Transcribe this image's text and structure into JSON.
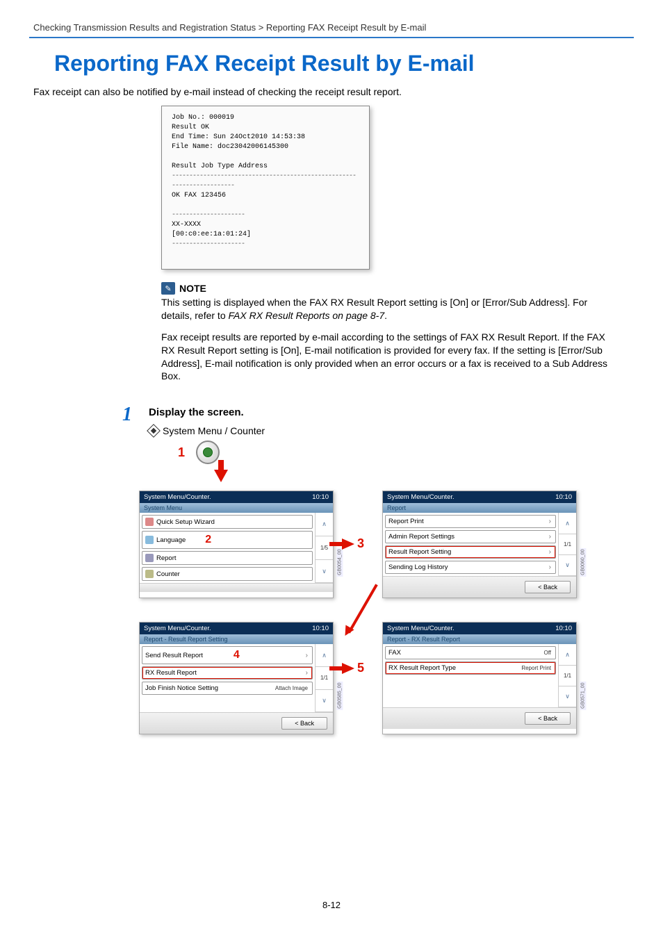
{
  "breadcrumb": "Checking Transmission Results and Registration Status > Reporting FAX Receipt Result by E-mail",
  "title": "Reporting FAX Receipt Result by E-mail",
  "intro": "Fax receipt can also be notified by e-mail instead of checking the receipt result report.",
  "sample": {
    "line1": "Job No.:  000019",
    "line2": "Result   OK",
    "line3": "End Time: Sun 24Oct2010 14:53:38",
    "line4": "File Name: doc23042006145300",
    "hdr": "Result  Job Type   Address",
    "row": " OK     FAX        123456",
    "footer1": "XX-XXXX",
    "footer2": "[00:c0:ee:1a:01:24]"
  },
  "note": {
    "heading": "NOTE",
    "text_a": "This setting is displayed when the FAX RX Result Report setting is [On] or [Error/Sub Address]. For details, refer to ",
    "text_a_link": "FAX RX Result Reports on page 8-7",
    "text_b": "Fax receipt results are reported by e-mail according to the settings of FAX RX Result Report. If the FAX RX Result Report setting is [On], E-mail notification is provided for every fax. If the setting is [Error/Sub Address], E-mail notification is only provided when an error occurs or a fax is received to a Sub Address Box."
  },
  "step1": {
    "num": "1",
    "title": "Display the screen.",
    "menu_label": "System Menu / Counter",
    "marker1": "1"
  },
  "panels": {
    "p1": {
      "title": "System Menu/Counter.",
      "time": "10:10",
      "sub": "System Menu",
      "items": [
        "Quick Setup Wizard",
        "Language",
        "Report",
        "Counter"
      ],
      "page": "1/5",
      "marker": "2",
      "tag": "GB0054_00"
    },
    "p2": {
      "title": "System Menu/Counter.",
      "time": "10:10",
      "sub": "Report",
      "items": [
        "Report Print",
        "Admin Report Settings",
        "Result Report Setting",
        "Sending Log History"
      ],
      "page": "1/1",
      "back": "< Back",
      "tag": "GB0060_00"
    },
    "p3": {
      "title": "System Menu/Counter.",
      "time": "10:10",
      "sub": "Report - Result Report Setting",
      "items": [
        {
          "label": "Send Result Report",
          "right": ""
        },
        {
          "label": "RX Result Report",
          "right": ""
        },
        {
          "label": "Job Finish Notice Setting",
          "right": "Attach Image"
        }
      ],
      "page": "1/1",
      "back": "< Back",
      "marker": "4",
      "tag": "GB0585_00"
    },
    "p4": {
      "title": "System Menu/Counter.",
      "time": "10:10",
      "sub": "Report - RX Result Report",
      "items": [
        {
          "label": "FAX",
          "right": "Off"
        },
        {
          "label": "RX Result Report Type",
          "right": "Report Print"
        }
      ],
      "page": "1/1",
      "back": "< Back",
      "tag": "GB0571_00"
    },
    "conn3": "3",
    "conn5": "5"
  },
  "pagenum": "8-12"
}
